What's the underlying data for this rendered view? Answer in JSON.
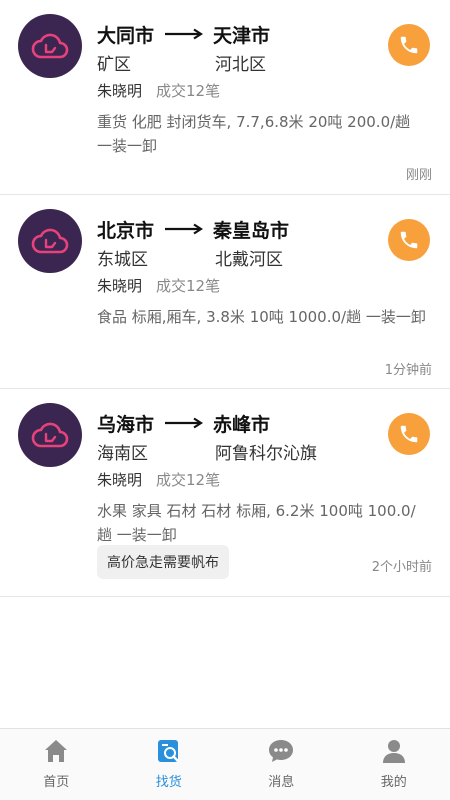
{
  "listings": [
    {
      "from_city": "大同市",
      "from_district": "矿区",
      "to_city": "天津市",
      "to_district": "河北区",
      "contact_name": "朱晓明",
      "deals": "成交12笔",
      "description": "重货 化肥 封闭货车, 7.7,6.8米 20吨 200.0/趟 一装一卸",
      "time": "刚刚"
    },
    {
      "from_city": "北京市",
      "from_district": "东城区",
      "to_city": "秦皇岛市",
      "to_district": "北戴河区",
      "contact_name": "朱晓明",
      "deals": "成交12笔",
      "description": "食品 标厢,厢车, 3.8米 10吨 1000.0/趟 一装一卸",
      "time": "1分钟前"
    },
    {
      "from_city": "乌海市",
      "from_district": "海南区",
      "to_city": "赤峰市",
      "to_district": "阿鲁科尔沁旗",
      "contact_name": "朱晓明",
      "deals": "成交12笔",
      "description": "水果 家具 石材 石材 标厢, 6.2米 100吨 100.0/趟 一装一卸",
      "tag": "高价急走需要帆布",
      "time": "2个小时前"
    }
  ],
  "tabbar": {
    "items": [
      {
        "label": "首页",
        "icon": "home-icon"
      },
      {
        "label": "找货",
        "icon": "find-goods-icon",
        "active": true
      },
      {
        "label": "消息",
        "icon": "message-icon"
      },
      {
        "label": "我的",
        "icon": "profile-icon"
      }
    ]
  },
  "colors": {
    "avatar_bg": "#3a2650",
    "avatar_logo": "#e8427c",
    "phone_button": "#f7a03c",
    "tab_active": "#2a8fdc"
  }
}
